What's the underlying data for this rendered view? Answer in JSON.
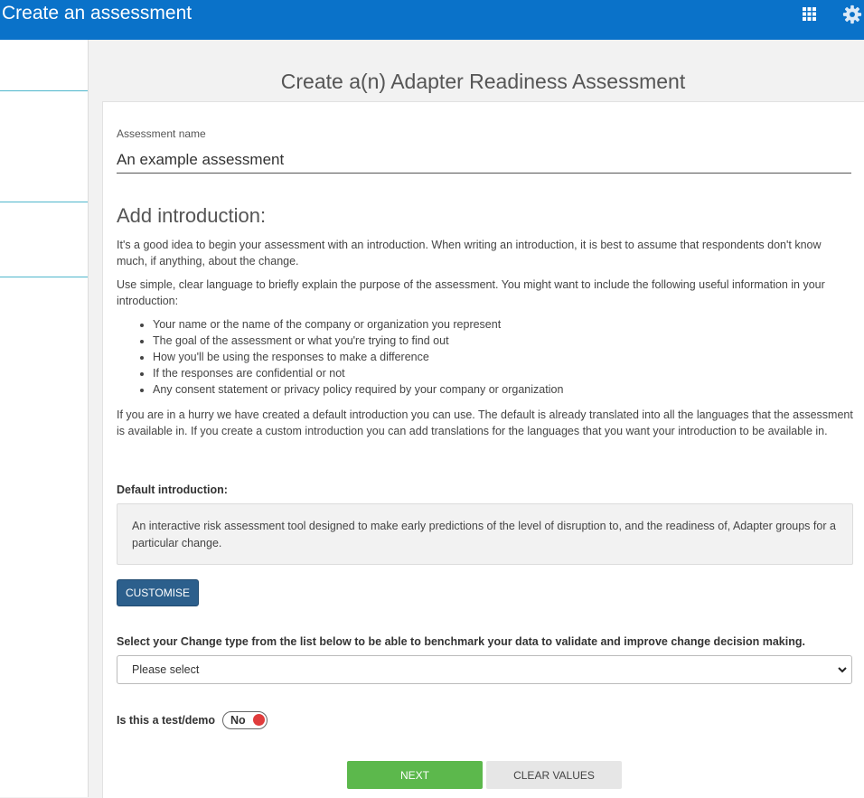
{
  "header": {
    "title": "Create an assessment",
    "apps_icon": "grid-icon",
    "settings_icon": "gear-icon",
    "accent": "#0a72c9"
  },
  "page": {
    "heading": "Create a(n) Adapter Readiness Assessment"
  },
  "form": {
    "name_label": "Assessment name",
    "name_value": "An example assessment",
    "intro_heading": "Add introduction:",
    "intro_p1": "It's a good idea to begin your assessment with an introduction. When writing an introduction, it is best to assume that respondents don't know much, if anything, about the change.",
    "intro_p2": "Use simple, clear language to briefly explain the purpose of the assessment. You might want to include the following useful information in your introduction:",
    "bullets": [
      "Your name or the name of the company or organization you represent",
      "The goal of the assessment or what you're trying to find out",
      "How you'll be using the responses to make a difference",
      "If the responses are confidential or not",
      "Any consent statement or privacy policy required by your company or organization"
    ],
    "intro_p3": "If you are in a hurry we have created a default introduction you can use. The default is already translated into all the languages that the assessment is available in. If you create a custom introduction you can add translations for the languages that you want your introduction to be available in.",
    "default_label": "Default introduction:",
    "default_text": "An interactive risk assessment tool designed to make early predictions of the level of disruption to, and the readiness of, Adapter groups for a particular change.",
    "customise_label": "CUSTOMISE",
    "change_type_label": "Select your Change type from the list below to be able to benchmark your data to validate and improve change decision making.",
    "change_type_value": "Please select",
    "test_label": "Is this a test/demo",
    "test_toggle": "No",
    "next_label": "NEXT",
    "clear_label": "CLEAR VALUES"
  }
}
